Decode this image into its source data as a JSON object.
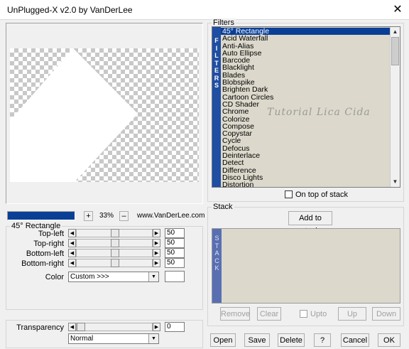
{
  "window": {
    "title": "UnPlugged-X v2.0 by VanDerLee",
    "close_glyph": "✕"
  },
  "filters": {
    "group_label": "Filters",
    "vertical_label": "FILTERS",
    "items": [
      "45° Rectangle",
      "Acid Waterfall",
      "Anti-Alias",
      "Auto Ellipse",
      "Barcode",
      "Blacklight",
      "Blades",
      "Blobspike",
      "Brighten Dark",
      "Cartoon Circles",
      "CD Shader",
      "Chrome",
      "Colorize",
      "Compose",
      "Copystar",
      "Cycle",
      "Defocus",
      "Deinterlace",
      "Detect",
      "Difference",
      "Disco Lights",
      "Distortion"
    ],
    "selected_index": 0,
    "on_top_label": "On top of stack",
    "on_top_checked": false
  },
  "zoom": {
    "plus": "+",
    "value": "33%",
    "minus": "–",
    "website": "www.VanDerLee.com"
  },
  "params": {
    "group_label": "45° Rectangle",
    "sliders": [
      {
        "label": "Top-left",
        "value": "50",
        "level": 0.5
      },
      {
        "label": "Top-right",
        "value": "50",
        "level": 0.5
      },
      {
        "label": "Bottom-left",
        "value": "50",
        "level": 0.5
      },
      {
        "label": "Bottom-right",
        "value": "50",
        "level": 0.5
      }
    ],
    "color_label": "Color",
    "color_value": "Custom >>>",
    "color_swatch": "#ffffff"
  },
  "transparency": {
    "label": "Transparency",
    "value": "0",
    "level": 0,
    "blend_mode": "Normal"
  },
  "stack": {
    "group_label": "Stack",
    "add_label": "Add to stack",
    "vertical_label": "STACK",
    "remove_label": "Remove",
    "clear_label": "Clear",
    "upto_label": "Upto",
    "up_label": "Up",
    "down_label": "Down"
  },
  "footer": {
    "open": "Open",
    "save": "Save",
    "delete": "Delete",
    "help": "?",
    "cancel": "Cancel",
    "ok": "OK"
  },
  "watermark": "Tutorial Lica Cida",
  "colors": {
    "accent": "#1f4ea3",
    "selection": "#0a3f96",
    "list_bg": "#dcd9cc",
    "stack_bar": "#5a6fb2",
    "progress": "#0a3f96"
  },
  "progress": {
    "level": 1.0
  }
}
